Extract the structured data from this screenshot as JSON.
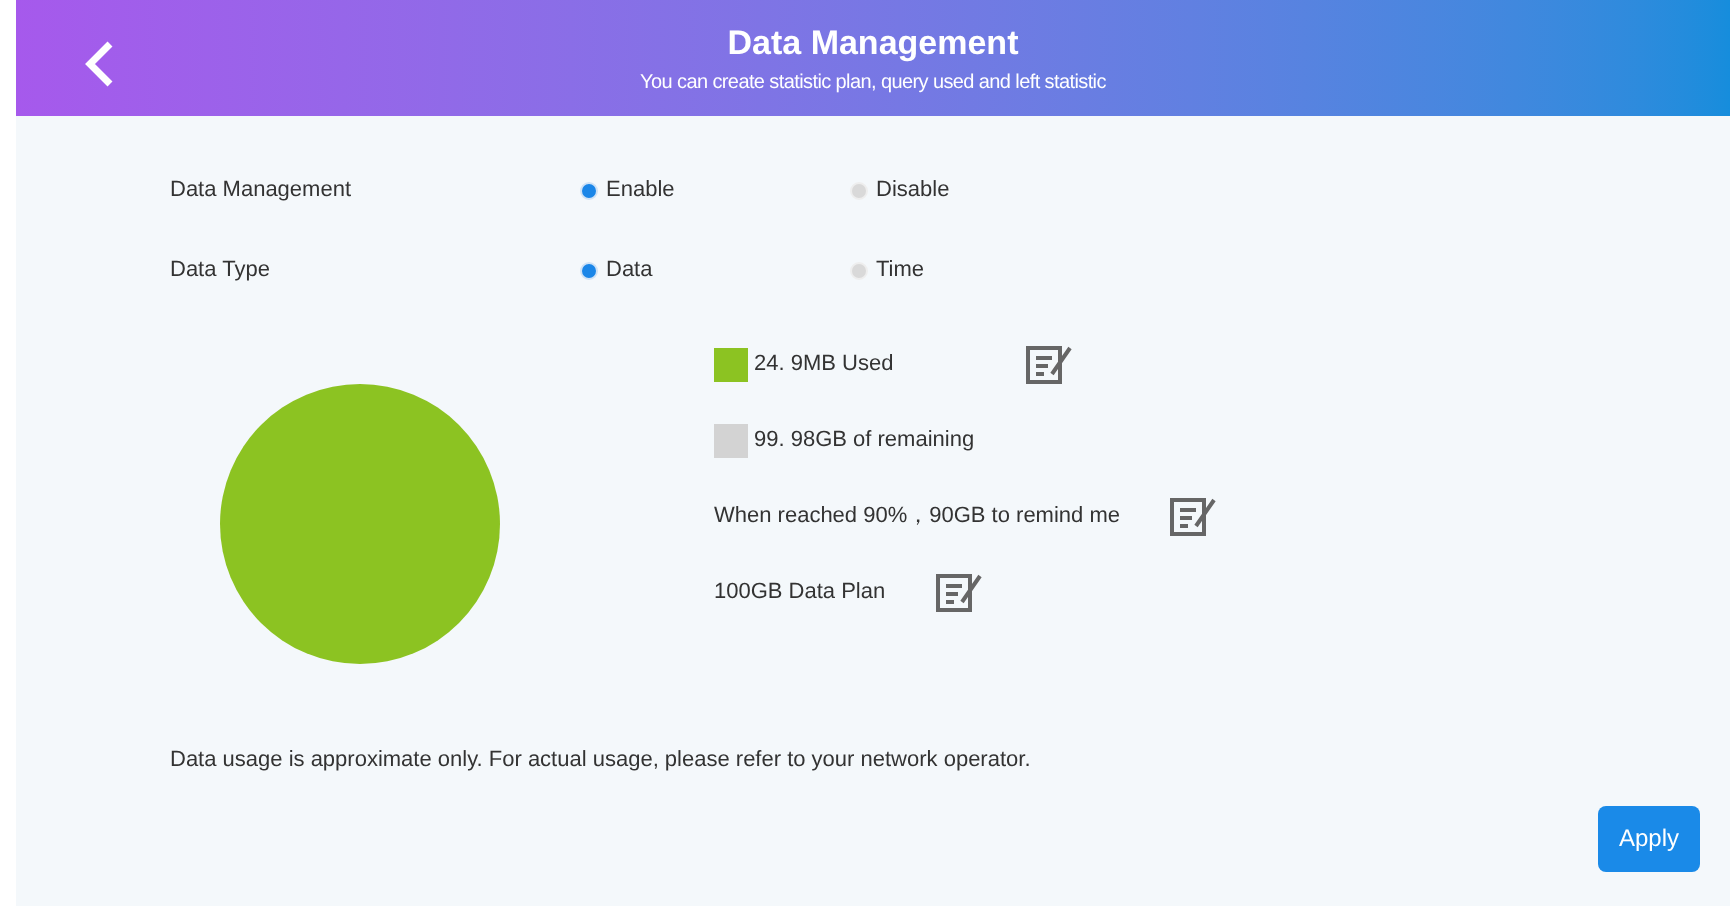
{
  "header": {
    "title": "Data Management",
    "subtitle": "You can create statistic plan, query used and left statistic"
  },
  "settings": [
    {
      "label": "Data Management",
      "options": [
        {
          "label": "Enable",
          "selected": true
        },
        {
          "label": "Disable",
          "selected": false
        }
      ]
    },
    {
      "label": "Data Type",
      "options": [
        {
          "label": "Data",
          "selected": true
        },
        {
          "label": "Time",
          "selected": false
        }
      ]
    }
  ],
  "legend": [
    {
      "kind": "swatch",
      "text": "24. 9MB Used",
      "color": "#8cc322",
      "editable": true
    },
    {
      "kind": "swatch",
      "text": "99. 98GB of remaining",
      "color": "#d3d3d3",
      "editable": false
    },
    {
      "kind": "text",
      "text": "When reached 90%，90GB to remind me",
      "editable": true
    },
    {
      "kind": "text",
      "text": "100GB Data Plan",
      "editable": true
    }
  ],
  "note": "Data usage is approximate only. For actual usage, please refer to your network operator.",
  "apply_button": "Apply"
}
